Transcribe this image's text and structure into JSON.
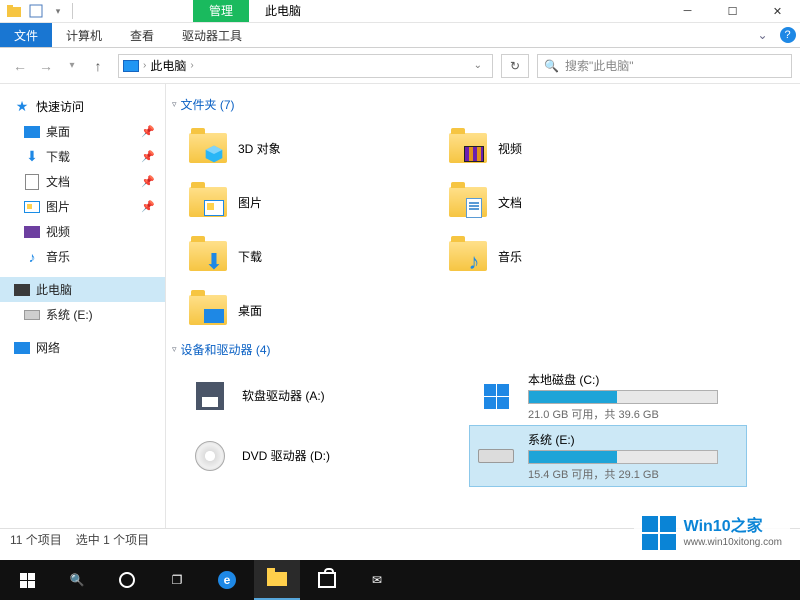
{
  "title_tab_context": "管理",
  "window_title": "此电脑",
  "ribbon": {
    "file": "文件",
    "computer": "计算机",
    "view": "查看",
    "drive_tools": "驱动器工具"
  },
  "addressbar": {
    "location": "此电脑",
    "sep": "›"
  },
  "search": {
    "placeholder": "搜索\"此电脑\""
  },
  "sidebar": {
    "quick_access": "快速访问",
    "desktop": "桌面",
    "downloads": "下载",
    "documents": "文档",
    "pictures": "图片",
    "videos": "视频",
    "music": "音乐",
    "this_pc": "此电脑",
    "system_e": "系统 (E:)",
    "network": "网络"
  },
  "groups": {
    "folders": "文件夹 (7)",
    "devices": "设备和驱动器 (4)"
  },
  "folders": {
    "objects3d": "3D 对象",
    "videos": "视频",
    "pictures": "图片",
    "documents": "文档",
    "downloads": "下载",
    "music": "音乐",
    "desktop": "桌面"
  },
  "drives": {
    "floppy": {
      "name": "软盘驱动器 (A:)"
    },
    "c": {
      "name": "本地磁盘 (C:)",
      "free": "21.0 GB 可用，共 39.6 GB",
      "fill_pct": 47
    },
    "dvd": {
      "name": "DVD 驱动器 (D:)"
    },
    "e": {
      "name": "系统 (E:)",
      "free": "15.4 GB 可用，共 29.1 GB",
      "fill_pct": 47
    }
  },
  "status": {
    "count": "11 个项目",
    "selected": "选中 1 个项目"
  },
  "watermark": {
    "brand": "Win10之家",
    "url": "www.win10xitong.com"
  }
}
